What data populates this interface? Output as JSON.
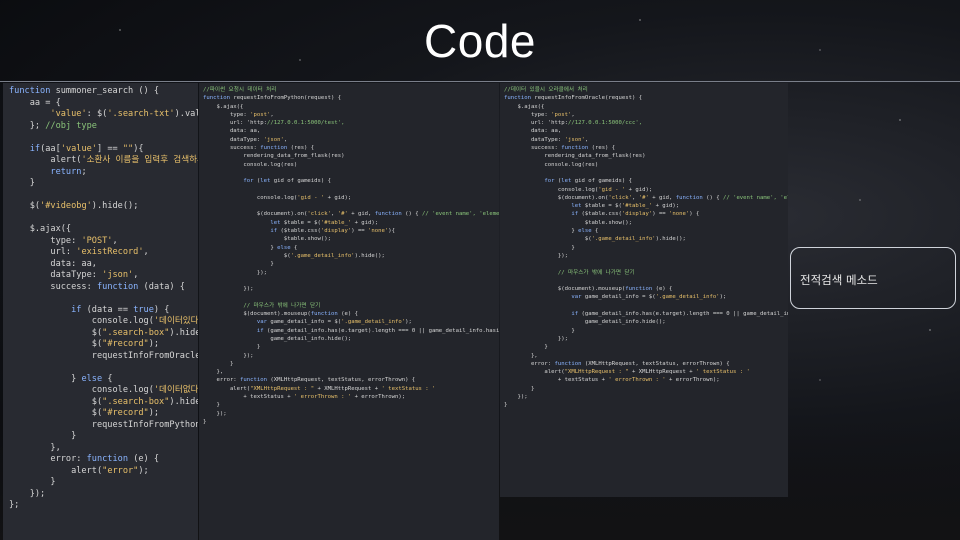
{
  "slide": {
    "title": "Code",
    "note": "전적검색 메소드"
  },
  "panels": {
    "main_code": "function summoner_search () {\n    aa = {\n        'value': $('.search-txt').val()\n    }; //obj type\n\n    if(aa['value'] == \"\"){\n        alert('소환사 이름을 입력후 검색하세요 !')\n        return;\n    }\n\n    $('#videobg').hide();\n\n    $.ajax({\n        type: 'POST',\n        url: 'existRecord',\n        data: aa,\n        dataType: 'json',\n        success: function (data) {\n\n            if (data == true) {\n                console.log('데이터있다');\n                $(\".search-box\").hide();\n                $(\"#record\");\n                requestInfoFromOracle(aa);\n\n            } else {\n                console.log('데이터없다');\n                $(\".search-box\").hide();\n                $(\"#record\");\n                requestInfoFromPython(aa);\n            }\n        },\n        error: function (e) {\n            alert(\"error\");\n        }\n    });\n};",
    "python_code": "//파이썬 요청시 데이터 처리\nfunction requestInfoFromPython(request) {\n    $.ajax({\n        type: 'post',\n        url: 'http://127.0.0.1:5000/test',\n        data: aa,\n        dataType: 'json',\n        success: function (res) {\n            rendering_data_from_flask(res)\n            console.log(res)\n\n            for (let gid of gameids) {\n\n                console.log('gid - ' + gid);\n\n                $(document).on('click', '#' + gid, function () { // 'event name', 'element id', event function() that you want\n                    let $table = $('#table_' + gid);\n                    if ($table.css('display') == 'none'){\n                        $table.show();\n                    } else {\n                        $('.game_detail_info').hide();\n                    }\n                });\n\n            });\n\n            // 마우스가 밖에 나가면 닫기\n            $(document).mouseup(function (e) {\n                var game_detail_info = $('.game_detail_info');\n                if (game_detail_info.has(e.target).length === 0 || game_detail_info.hasis(e.target).length !== 0) {\n                    game_detail_info.hide();\n                }\n            });\n        }\n    },\n    error: function (XMLHttpRequest, textStatus, errorThrown) {\n        alert(\"XMLHttpRequest : \" + XMLHttpRequest + ' textStatus : '\n            + textStatus + ' errorThrown : ' + errorThrown);\n    }\n    });\n}",
    "oracle_code": "//데이터 있을시 오라클에서 처리\nfunction requestInfoFromOracle(request) {\n    $.ajax({\n        type: 'post',\n        url: 'http://127.0.0.1:5000/ccc',\n        data: aa,\n        dataType: 'json',\n        success: function (res) {\n            rendering_data_from_flask(res)\n            console.log(res)\n\n            for (let gid of gameids) {\n                console.log('gid - ' + gid);\n                $(document).on('click', '#' + gid, function () { // 'event name', 'element id', event function() that\n                    let $table = $('#table_' + gid);\n                    if ($table.css('display') == 'none') {\n                        $table.show();\n                    } else {\n                        $('.game_detail_info').hide();\n                    }\n                });\n\n                // 마우스가 밖에 나가면 닫기\n\n                $(document).mouseup(function (e) {\n                    var game_detail_info = $('.game_detail_info');\n\n                    if (game_detail_info.has(e.target).length === 0 || game_detail_info.hasis(e.target).length !== 0) {\n                        game_detail_info.hide();\n                    }\n                });\n            }\n        },\n        error: function (XMLHttpRequest, textStatus, errorThrown) {\n            alert(\"XMLHttpRequest : \" + XMLHttpRequest + ' textStatus : '\n                + textStatus + ' errorThrown : ' + errorThrown);\n        }\n    });\n}"
  },
  "colors": {
    "keyword": "#8ab4ff",
    "string": "#e8c06a",
    "comment": "#8ac47a",
    "panel_bg": "#282a31"
  }
}
